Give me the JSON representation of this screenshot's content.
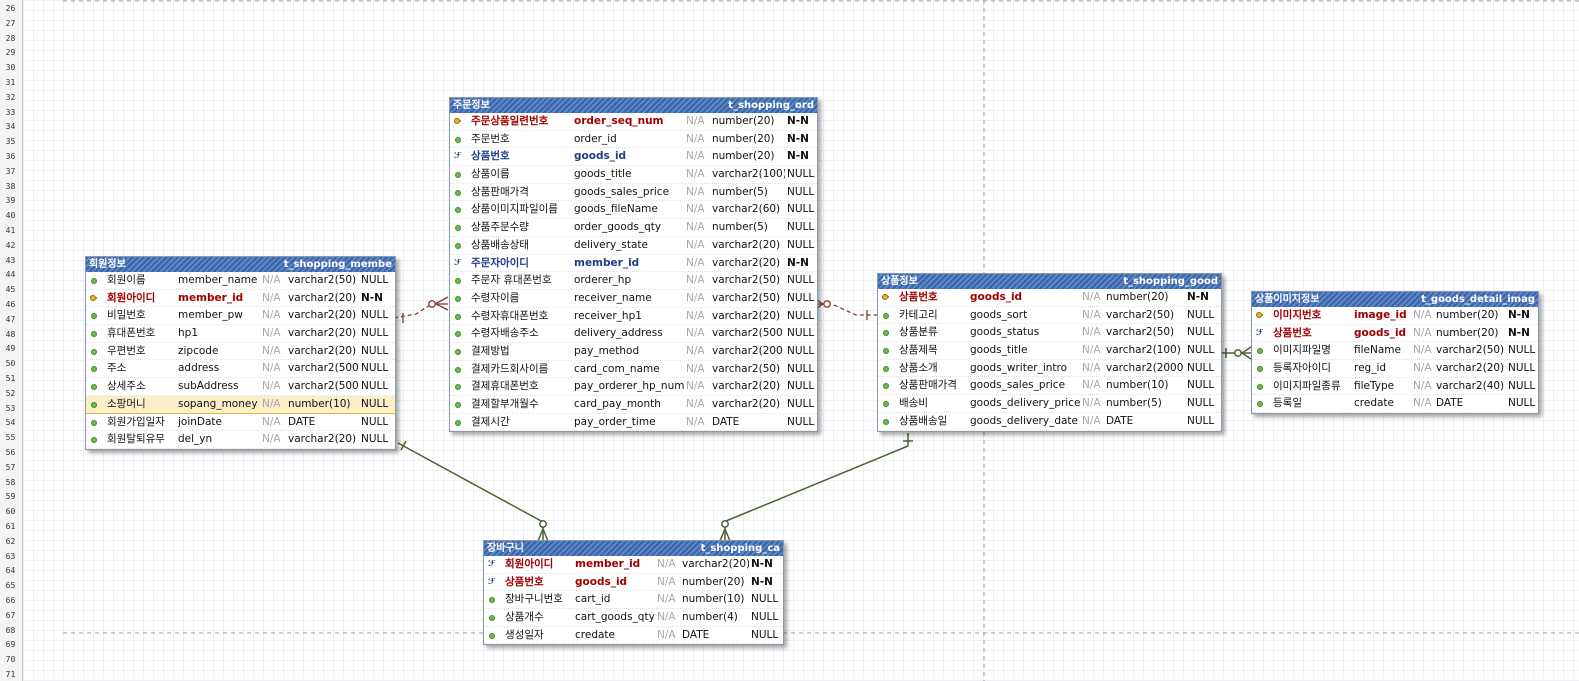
{
  "ruler_numbers": [
    "26",
    "27",
    "28",
    "29",
    "30",
    "31",
    "32",
    "33",
    "34",
    "35",
    "36",
    "37",
    "38",
    "39",
    "40",
    "41",
    "42",
    "43",
    "44",
    "45",
    "46",
    "47",
    "48",
    "49",
    "50",
    "51",
    "52",
    "53",
    "54",
    "55",
    "56",
    "57",
    "58",
    "59",
    "60",
    "61",
    "62",
    "63",
    "64",
    "65",
    "66",
    "67",
    "68",
    "69",
    "70",
    "71"
  ],
  "colors": {
    "header": "#3b64a8",
    "pk_text": "#a00000",
    "fk_text": "#1c3e86",
    "identifying_relation": "#4a6236",
    "nonidentifying_relation": "#8b3a2a"
  },
  "entities": {
    "member": {
      "logical": "회원정보",
      "physical": "t_shopping_membe",
      "rows": [
        {
          "icon": "attr-icon",
          "lname": "회원이름",
          "pname": "member_name",
          "na": "N/A",
          "type": "varchar2(50)",
          "nul": "NULL",
          "style": ""
        },
        {
          "icon": "pk-icon",
          "lname": "회원아이디",
          "pname": "member_id",
          "na": "N/A",
          "type": "varchar2(20)",
          "nul": "N-N",
          "style": "key"
        },
        {
          "icon": "attr-icon",
          "lname": "비밀번호",
          "pname": "member_pw",
          "na": "N/A",
          "type": "varchar2(20)",
          "nul": "NULL",
          "style": ""
        },
        {
          "icon": "attr-icon",
          "lname": "휴대폰번호",
          "pname": "hp1",
          "na": "N/A",
          "type": "varchar2(20)",
          "nul": "NULL",
          "style": ""
        },
        {
          "icon": "attr-icon",
          "lname": "우편번호",
          "pname": "zipcode",
          "na": "N/A",
          "type": "varchar2(20)",
          "nul": "NULL",
          "style": ""
        },
        {
          "icon": "attr-icon",
          "lname": "주소",
          "pname": "address",
          "na": "N/A",
          "type": "varchar2(500",
          "nul": "NULL",
          "style": ""
        },
        {
          "icon": "attr-icon",
          "lname": "상세주소",
          "pname": "subAddress",
          "na": "N/A",
          "type": "varchar2(500",
          "nul": "NULL",
          "style": ""
        },
        {
          "icon": "attr-icon",
          "lname": "소팡머니",
          "pname": "sopang_money",
          "na": "N/A",
          "type": "number(10)",
          "nul": "NULL",
          "style": "hl"
        },
        {
          "icon": "attr-icon",
          "lname": "회원가입일자",
          "pname": "joinDate",
          "na": "N/A",
          "type": "DATE",
          "nul": "NULL",
          "style": ""
        },
        {
          "icon": "attr-icon",
          "lname": "회원탈퇴유무",
          "pname": "del_yn",
          "na": "N/A",
          "type": "varchar2(20)",
          "nul": "NULL",
          "style": ""
        }
      ]
    },
    "order": {
      "logical": "주문정보",
      "physical": "t_shopping_ord",
      "rows": [
        {
          "icon": "pk-icon",
          "lname": "주문상품일련번호",
          "pname": "order_seq_num",
          "na": "N/A",
          "type": "number(20)",
          "nul": "N-N",
          "style": "key"
        },
        {
          "icon": "attr-icon",
          "lname": "주문번호",
          "pname": "order_id",
          "na": "N/A",
          "type": "number(20)",
          "nul": "N-N",
          "style": ""
        },
        {
          "icon": "fk-icon",
          "lname": "상품번호",
          "pname": "goods_id",
          "na": "N/A",
          "type": "number(20)",
          "nul": "N-N",
          "style": "fkey"
        },
        {
          "icon": "attr-icon",
          "lname": "상품이름",
          "pname": "goods_title",
          "na": "N/A",
          "type": "varchar2(100)",
          "nul": "NULL",
          "style": ""
        },
        {
          "icon": "attr-icon",
          "lname": "상품판매가격",
          "pname": "goods_sales_price",
          "na": "N/A",
          "type": "number(5)",
          "nul": "NULL",
          "style": ""
        },
        {
          "icon": "attr-icon",
          "lname": "상품이미지파일이름",
          "pname": "goods_fileName",
          "na": "N/A",
          "type": "varchar2(60)",
          "nul": "NULL",
          "style": ""
        },
        {
          "icon": "attr-icon",
          "lname": "상품주문수량",
          "pname": "order_goods_qty",
          "na": "N/A",
          "type": "number(5)",
          "nul": "NULL",
          "style": ""
        },
        {
          "icon": "attr-icon",
          "lname": "상품배송상태",
          "pname": "delivery_state",
          "na": "N/A",
          "type": "varchar2(20)",
          "nul": "NULL",
          "style": ""
        },
        {
          "icon": "fk-icon",
          "lname": "주문자아이디",
          "pname": "member_id",
          "na": "N/A",
          "type": "varchar2(20)",
          "nul": "N-N",
          "style": "fkey"
        },
        {
          "icon": "attr-icon",
          "lname": "주문자 휴대폰번호",
          "pname": "orderer_hp",
          "na": "N/A",
          "type": "varchar2(50)",
          "nul": "NULL",
          "style": ""
        },
        {
          "icon": "attr-icon",
          "lname": "수령자이름",
          "pname": "receiver_name",
          "na": "N/A",
          "type": "varchar2(50)",
          "nul": "NULL",
          "style": ""
        },
        {
          "icon": "attr-icon",
          "lname": "수령자휴대폰번호",
          "pname": "receiver_hp1",
          "na": "N/A",
          "type": "varchar2(20)",
          "nul": "NULL",
          "style": ""
        },
        {
          "icon": "attr-icon",
          "lname": "수령자배송주소",
          "pname": "delivery_address",
          "na": "N/A",
          "type": "varchar2(500",
          "nul": "NULL",
          "style": ""
        },
        {
          "icon": "attr-icon",
          "lname": "결제방법",
          "pname": "pay_method",
          "na": "N/A",
          "type": "varchar2(200",
          "nul": "NULL",
          "style": ""
        },
        {
          "icon": "attr-icon",
          "lname": "결제카드회사이름",
          "pname": "card_com_name",
          "na": "N/A",
          "type": "varchar2(50)",
          "nul": "NULL",
          "style": ""
        },
        {
          "icon": "attr-icon",
          "lname": "결제휴대폰번호",
          "pname": "pay_orderer_hp_num",
          "na": "N/A",
          "type": "varchar2(20)",
          "nul": "NULL",
          "style": ""
        },
        {
          "icon": "attr-icon",
          "lname": "결제할부개월수",
          "pname": "card_pay_month",
          "na": "N/A",
          "type": "varchar2(20)",
          "nul": "NULL",
          "style": ""
        },
        {
          "icon": "attr-icon",
          "lname": "결제시간",
          "pname": "pay_order_time",
          "na": "N/A",
          "type": "DATE",
          "nul": "NULL",
          "style": ""
        }
      ]
    },
    "goods": {
      "logical": "상품정보",
      "physical": "t_shopping_good",
      "rows": [
        {
          "icon": "pk-icon",
          "lname": "상품번호",
          "pname": "goods_id",
          "na": "N/A",
          "type": "number(20)",
          "nul": "N-N",
          "style": "key"
        },
        {
          "icon": "attr-icon",
          "lname": "카테고리",
          "pname": "goods_sort",
          "na": "N/A",
          "type": "varchar2(50)",
          "nul": "NULL",
          "style": ""
        },
        {
          "icon": "attr-icon",
          "lname": "상품분류",
          "pname": "goods_status",
          "na": "N/A",
          "type": "varchar2(50)",
          "nul": "NULL",
          "style": ""
        },
        {
          "icon": "attr-icon",
          "lname": "상품제목",
          "pname": "goods_title",
          "na": "N/A",
          "type": "varchar2(100)",
          "nul": "NULL",
          "style": ""
        },
        {
          "icon": "attr-icon",
          "lname": "상품소개",
          "pname": "goods_writer_intro",
          "na": "N/A",
          "type": "varchar2(2000",
          "nul": "NULL",
          "style": ""
        },
        {
          "icon": "attr-icon",
          "lname": "상품판매가격",
          "pname": "goods_sales_price",
          "na": "N/A",
          "type": "number(10)",
          "nul": "NULL",
          "style": ""
        },
        {
          "icon": "attr-icon",
          "lname": "배송비",
          "pname": "goods_delivery_price",
          "na": "N/A",
          "type": "number(5)",
          "nul": "NULL",
          "style": ""
        },
        {
          "icon": "attr-icon",
          "lname": "상품배송일",
          "pname": "goods_delivery_date",
          "na": "N/A",
          "type": "DATE",
          "nul": "NULL",
          "style": ""
        }
      ]
    },
    "image": {
      "logical": "상품이미지정보",
      "physical": "t_goods_detail_imag",
      "rows": [
        {
          "icon": "pk-icon",
          "lname": "이미지번호",
          "pname": "image_id",
          "na": "N/A",
          "type": "number(20)",
          "nul": "N-N",
          "style": "key"
        },
        {
          "icon": "pfk-icon",
          "lname": "상품번호",
          "pname": "goods_id",
          "na": "N/A",
          "type": "number(20)",
          "nul": "N-N",
          "style": "pf"
        },
        {
          "icon": "attr-icon",
          "lname": "이미지파일명",
          "pname": "fileName",
          "na": "N/A",
          "type": "varchar2(50)",
          "nul": "NULL",
          "style": ""
        },
        {
          "icon": "attr-icon",
          "lname": "등록자아이디",
          "pname": "reg_id",
          "na": "N/A",
          "type": "varchar2(20)",
          "nul": "NULL",
          "style": ""
        },
        {
          "icon": "attr-icon",
          "lname": "이미지파일종류",
          "pname": "fileType",
          "na": "N/A",
          "type": "varchar2(40)",
          "nul": "NULL",
          "style": ""
        },
        {
          "icon": "attr-icon",
          "lname": "등록일",
          "pname": "credate",
          "na": "N/A",
          "type": "DATE",
          "nul": "NULL",
          "style": ""
        }
      ]
    },
    "cart": {
      "logical": "장바구니",
      "physical": "t_shopping_ca",
      "rows": [
        {
          "icon": "pfk-icon",
          "lname": "회원아이디",
          "pname": "member_id",
          "na": "N/A",
          "type": "varchar2(20)",
          "nul": "N-N",
          "style": "pf"
        },
        {
          "icon": "pfk-icon",
          "lname": "상품번호",
          "pname": "goods_id",
          "na": "N/A",
          "type": "number(20)",
          "nul": "N-N",
          "style": "pf"
        },
        {
          "icon": "attr-icon",
          "lname": "장바구니번호",
          "pname": "cart_id",
          "na": "N/A",
          "type": "number(10)",
          "nul": "NULL",
          "style": ""
        },
        {
          "icon": "attr-icon",
          "lname": "상품개수",
          "pname": "cart_goods_qty",
          "na": "N/A",
          "type": "number(4)",
          "nul": "NULL",
          "style": ""
        },
        {
          "icon": "attr-icon",
          "lname": "생성일자",
          "pname": "credate",
          "na": "N/A",
          "type": "DATE",
          "nul": "NULL",
          "style": ""
        }
      ]
    }
  }
}
